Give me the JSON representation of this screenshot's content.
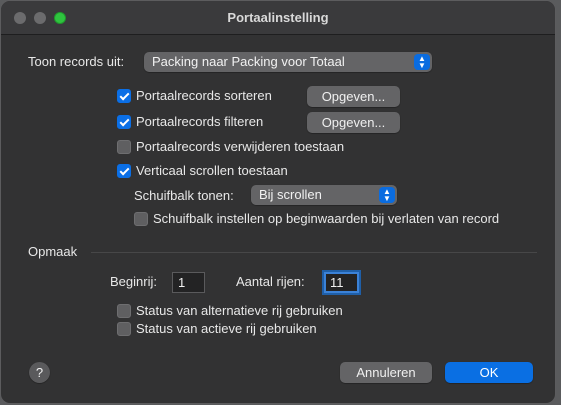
{
  "window": {
    "title": "Portaalinstelling"
  },
  "show_records": {
    "label": "Toon records uit:",
    "value": "Packing naar Packing voor Totaal"
  },
  "sort": {
    "label": "Portaalrecords sorteren",
    "checked": true,
    "button": "Opgeven..."
  },
  "filter": {
    "label": "Portaalrecords filteren",
    "checked": true,
    "button": "Opgeven..."
  },
  "delete": {
    "label": "Portaalrecords verwijderen toestaan",
    "checked": false
  },
  "vscroll": {
    "label": "Verticaal scrollen toestaan",
    "checked": true
  },
  "scrollbar": {
    "label": "Schuifbalk tonen:",
    "value": "Bij scrollen"
  },
  "reset_scroll": {
    "label": "Schuifbalk instellen op beginwaarden bij verlaten van record",
    "checked": false
  },
  "format": {
    "section_label": "Opmaak",
    "start_row_label": "Beginrij:",
    "start_row_value": "1",
    "row_count_label": "Aantal rijen:",
    "row_count_value": "11",
    "alt_row": {
      "label": "Status van alternatieve rij gebruiken",
      "checked": false
    },
    "active_row": {
      "label": "Status van actieve rij gebruiken",
      "checked": false
    }
  },
  "footer": {
    "help": "?",
    "cancel": "Annuleren",
    "ok": "OK"
  },
  "colors": {
    "accent": "#0a6fe3",
    "window_bg": "#323233",
    "maximize": "#2fc33f"
  }
}
